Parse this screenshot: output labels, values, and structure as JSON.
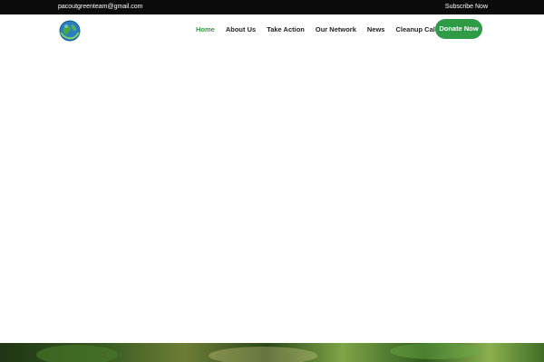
{
  "topbar": {
    "email": "pacoutgreenteam@gmail.com",
    "subscribe_label": "Subscribe Now"
  },
  "brand": {
    "logo_icon": "earth-globe-icon",
    "accent_color": "#2f9b46"
  },
  "nav": {
    "items": [
      {
        "label": "Home",
        "active": true
      },
      {
        "label": "About Us",
        "active": false
      },
      {
        "label": "Take Action",
        "active": false
      },
      {
        "label": "Our Network",
        "active": false
      },
      {
        "label": "News",
        "active": false
      },
      {
        "label": "Cleanup Calendar",
        "active": false
      }
    ],
    "donate_label": "Donate Now"
  }
}
